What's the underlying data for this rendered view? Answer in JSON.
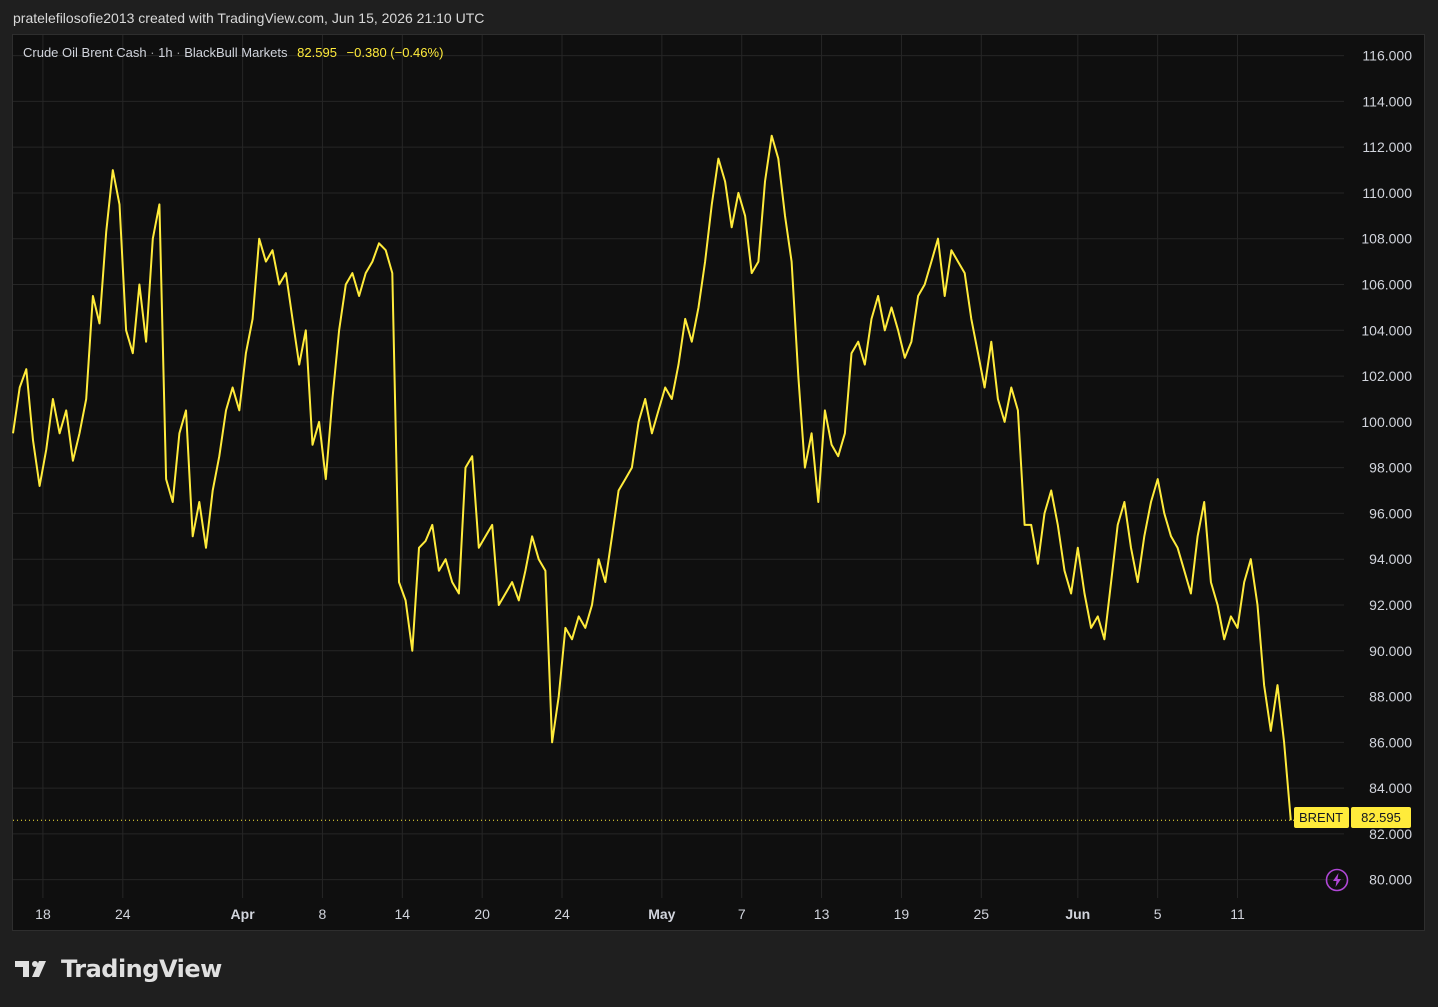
{
  "header": {
    "attribution": "pratelefilosofie2013 created with TradingView.com, Jun 15, 2026 21:10 UTC"
  },
  "legend": {
    "symbol": "Crude Oil Brent Cash",
    "interval": "1h",
    "broker": "BlackBull Markets",
    "dot": "·",
    "last": "82.595",
    "change": "−0.380 (−0.46%)"
  },
  "price_label": {
    "symbol": "BRENT",
    "value": "82.595"
  },
  "branding": {
    "name": "TradingView"
  },
  "colors": {
    "line": "#ffeb3b",
    "background": "#0f0f0f",
    "grid": "#262626",
    "text": "#d1d4dc",
    "bolt": "#b047d6"
  },
  "icons": {
    "logo": "tradingview-logo-icon",
    "bolt": "lightning-bolt-icon"
  },
  "chart_data": {
    "type": "line",
    "series": [
      {
        "name": "BRENT",
        "points": [
          [
            0,
            99.5
          ],
          [
            1,
            101.5
          ],
          [
            2,
            102.3
          ],
          [
            3,
            99.2
          ],
          [
            4,
            97.2
          ],
          [
            5,
            98.8
          ],
          [
            6,
            101
          ],
          [
            7,
            99.5
          ],
          [
            8,
            100.5
          ],
          [
            9,
            98.3
          ],
          [
            10,
            99.5
          ],
          [
            11,
            101
          ],
          [
            12,
            105.5
          ],
          [
            13,
            104.3
          ],
          [
            14,
            108.3
          ],
          [
            15,
            111
          ],
          [
            16,
            109.5
          ],
          [
            17,
            104
          ],
          [
            18,
            103
          ],
          [
            19,
            106
          ],
          [
            20,
            103.5
          ],
          [
            21,
            108
          ],
          [
            22,
            109.5
          ],
          [
            23,
            97.5
          ],
          [
            24,
            96.5
          ],
          [
            25,
            99.5
          ],
          [
            26,
            100.5
          ],
          [
            27,
            95
          ],
          [
            28,
            96.5
          ],
          [
            29,
            94.5
          ],
          [
            30,
            97
          ],
          [
            31,
            98.5
          ],
          [
            32,
            100.5
          ],
          [
            33,
            101.5
          ],
          [
            34,
            100.5
          ],
          [
            35,
            103
          ],
          [
            36,
            104.5
          ],
          [
            37,
            108
          ],
          [
            38,
            107
          ],
          [
            39,
            107.5
          ],
          [
            40,
            106
          ],
          [
            41,
            106.5
          ],
          [
            42,
            104.5
          ],
          [
            43,
            102.5
          ],
          [
            44,
            104
          ],
          [
            45,
            99
          ],
          [
            46,
            100
          ],
          [
            47,
            97.5
          ],
          [
            48,
            101
          ],
          [
            49,
            104
          ],
          [
            50,
            106
          ],
          [
            51,
            106.5
          ],
          [
            52,
            105.5
          ],
          [
            53,
            106.5
          ],
          [
            54,
            107
          ],
          [
            55,
            107.8
          ],
          [
            56,
            107.5
          ],
          [
            57,
            106.5
          ],
          [
            58,
            93
          ],
          [
            59,
            92.2
          ],
          [
            60,
            90
          ],
          [
            61,
            94.5
          ],
          [
            62,
            94.8
          ],
          [
            63,
            95.5
          ],
          [
            64,
            93.5
          ],
          [
            65,
            94
          ],
          [
            66,
            93
          ],
          [
            67,
            92.5
          ],
          [
            68,
            98
          ],
          [
            69,
            98.5
          ],
          [
            70,
            94.5
          ],
          [
            71,
            95
          ],
          [
            72,
            95.5
          ],
          [
            73,
            92
          ],
          [
            74,
            92.5
          ],
          [
            75,
            93
          ],
          [
            76,
            92.2
          ],
          [
            77,
            93.5
          ],
          [
            78,
            95
          ],
          [
            79,
            94
          ],
          [
            80,
            93.5
          ],
          [
            81,
            86
          ],
          [
            82,
            88
          ],
          [
            83,
            91
          ],
          [
            84,
            90.5
          ],
          [
            85,
            91.5
          ],
          [
            86,
            91
          ],
          [
            87,
            92
          ],
          [
            88,
            94
          ],
          [
            89,
            93
          ],
          [
            90,
            95
          ],
          [
            91,
            97
          ],
          [
            92,
            97.5
          ],
          [
            93,
            98
          ],
          [
            94,
            100
          ],
          [
            95,
            101
          ],
          [
            96,
            99.5
          ],
          [
            97,
            100.5
          ],
          [
            98,
            101.5
          ],
          [
            99,
            101
          ],
          [
            100,
            102.5
          ],
          [
            101,
            104.5
          ],
          [
            102,
            103.5
          ],
          [
            103,
            105
          ],
          [
            104,
            107
          ],
          [
            105,
            109.5
          ],
          [
            106,
            111.5
          ],
          [
            107,
            110.5
          ],
          [
            108,
            108.5
          ],
          [
            109,
            110
          ],
          [
            110,
            109
          ],
          [
            111,
            106.5
          ],
          [
            112,
            107
          ],
          [
            113,
            110.5
          ],
          [
            114,
            112.5
          ],
          [
            115,
            111.5
          ],
          [
            116,
            109
          ],
          [
            117,
            107
          ],
          [
            118,
            102
          ],
          [
            119,
            98
          ],
          [
            120,
            99.5
          ],
          [
            121,
            96.5
          ],
          [
            122,
            100.5
          ],
          [
            123,
            99
          ],
          [
            124,
            98.5
          ],
          [
            125,
            99.5
          ],
          [
            126,
            103
          ],
          [
            127,
            103.5
          ],
          [
            128,
            102.5
          ],
          [
            129,
            104.5
          ],
          [
            130,
            105.5
          ],
          [
            131,
            104
          ],
          [
            132,
            105
          ],
          [
            133,
            104
          ],
          [
            134,
            102.8
          ],
          [
            135,
            103.5
          ],
          [
            136,
            105.5
          ],
          [
            137,
            106
          ],
          [
            138,
            107
          ],
          [
            139,
            108
          ],
          [
            140,
            105.5
          ],
          [
            141,
            107.5
          ],
          [
            142,
            107
          ],
          [
            143,
            106.5
          ],
          [
            144,
            104.5
          ],
          [
            145,
            103
          ],
          [
            146,
            101.5
          ],
          [
            147,
            103.5
          ],
          [
            148,
            101
          ],
          [
            149,
            100
          ],
          [
            150,
            101.5
          ],
          [
            151,
            100.5
          ],
          [
            152,
            95.5
          ],
          [
            153,
            95.5
          ],
          [
            154,
            93.8
          ],
          [
            155,
            96
          ],
          [
            156,
            97
          ],
          [
            157,
            95.5
          ],
          [
            158,
            93.5
          ],
          [
            159,
            92.5
          ],
          [
            160,
            94.5
          ],
          [
            161,
            92.5
          ],
          [
            162,
            91
          ],
          [
            163,
            91.5
          ],
          [
            164,
            90.5
          ],
          [
            165,
            93
          ],
          [
            166,
            95.5
          ],
          [
            167,
            96.5
          ],
          [
            168,
            94.5
          ],
          [
            169,
            93
          ],
          [
            170,
            95
          ],
          [
            171,
            96.5
          ],
          [
            172,
            97.5
          ],
          [
            173,
            96
          ],
          [
            174,
            95
          ],
          [
            175,
            94.5
          ],
          [
            176,
            93.5
          ],
          [
            177,
            92.5
          ],
          [
            178,
            95
          ],
          [
            179,
            96.5
          ],
          [
            180,
            93
          ],
          [
            181,
            92
          ],
          [
            182,
            90.5
          ],
          [
            183,
            91.5
          ],
          [
            184,
            91
          ],
          [
            185,
            93
          ],
          [
            186,
            94
          ],
          [
            187,
            92
          ],
          [
            188,
            88.5
          ],
          [
            189,
            86.5
          ],
          [
            190,
            88.5
          ],
          [
            191,
            86
          ],
          [
            192,
            82.595
          ]
        ]
      }
    ],
    "x_ticks": [
      {
        "x": 4.5,
        "label": "18",
        "bold": false
      },
      {
        "x": 16.5,
        "label": "24",
        "bold": false
      },
      {
        "x": 34.5,
        "label": "Apr",
        "bold": true
      },
      {
        "x": 46.5,
        "label": "8",
        "bold": false
      },
      {
        "x": 58.5,
        "label": "14",
        "bold": false
      },
      {
        "x": 70.5,
        "label": "20",
        "bold": false
      },
      {
        "x": 82.5,
        "label": "24",
        "bold": false
      },
      {
        "x": 97.5,
        "label": "May",
        "bold": true
      },
      {
        "x": 109.5,
        "label": "7",
        "bold": false
      },
      {
        "x": 121.5,
        "label": "13",
        "bold": false
      },
      {
        "x": 133.5,
        "label": "19",
        "bold": false
      },
      {
        "x": 145.5,
        "label": "25",
        "bold": false
      },
      {
        "x": 160,
        "label": "Jun",
        "bold": true
      },
      {
        "x": 172,
        "label": "5",
        "bold": false
      },
      {
        "x": 184,
        "label": "11",
        "bold": false
      }
    ],
    "y_ticks": [
      "116.000",
      "114.000",
      "112.000",
      "110.000",
      "108.000",
      "106.000",
      "104.000",
      "102.000",
      "100.000",
      "98.000",
      "96.000",
      "94.000",
      "92.000",
      "90.000",
      "88.000",
      "86.000",
      "84.000",
      "82.000",
      "80.000"
    ],
    "ylim": [
      79.2,
      116.9
    ],
    "xlim": [
      0,
      200
    ],
    "last_value": 82.595,
    "grid": true,
    "legend": "top-left"
  }
}
